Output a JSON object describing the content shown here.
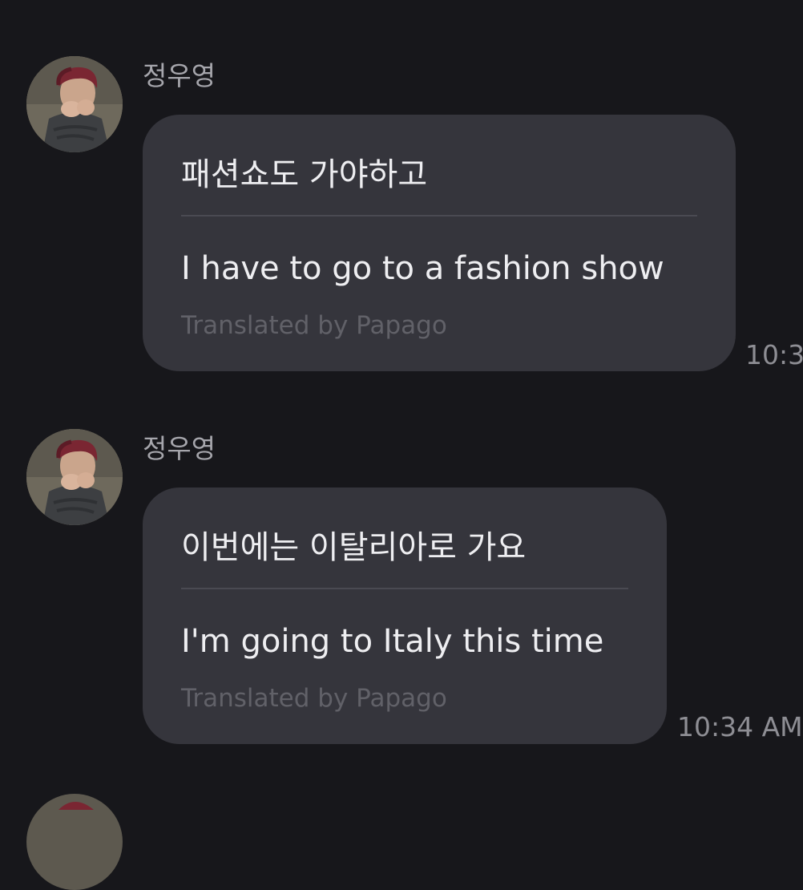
{
  "messages": [
    {
      "sender": "정우영",
      "original": "패션쇼도 가야하고",
      "translation": "I have to go to a fashion show",
      "credit": "Translated by Papago",
      "time": "10:3"
    },
    {
      "sender": "정우영",
      "original": "이번에는 이탈리아로 가요",
      "translation": "I'm going to Italy this time",
      "credit": "Translated by Papago",
      "time": "10:34 AM"
    }
  ],
  "colors": {
    "background": "#17171b",
    "bubble": "#35353c",
    "divider": "#4a4a52",
    "credit_text": "#616168",
    "timestamp": "#8e8e94"
  },
  "icons": {
    "avatar": "profile-photo-avatar"
  }
}
